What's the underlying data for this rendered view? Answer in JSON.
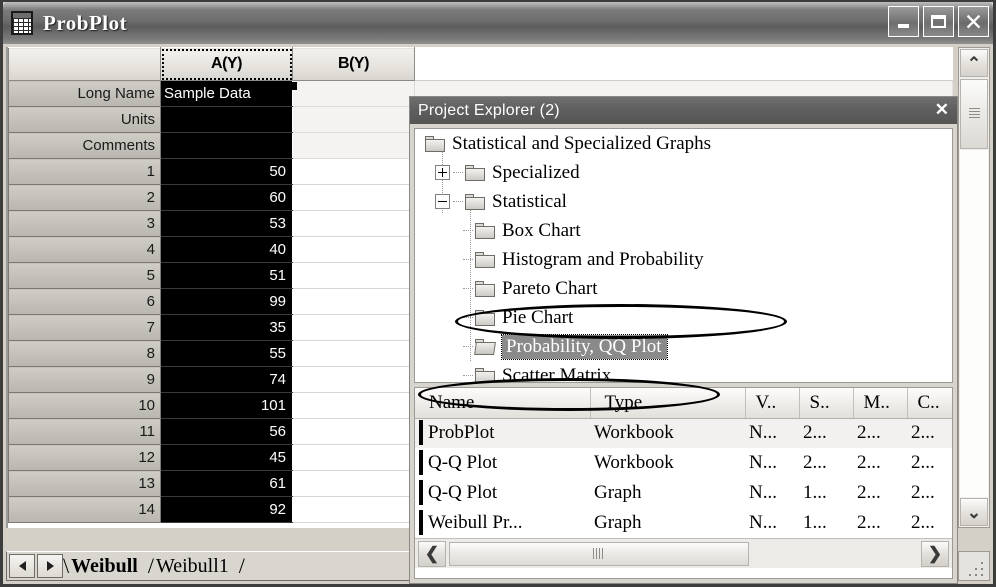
{
  "window": {
    "title": "ProbPlot",
    "icon": "workbook-icon",
    "buttons": {
      "minimize": "minimize-icon",
      "maximize": "maximize-icon",
      "close": "close-icon"
    }
  },
  "worksheet": {
    "columns": [
      {
        "id": "rowhdr",
        "label": ""
      },
      {
        "id": "A",
        "label": "A(Y)",
        "selected": true
      },
      {
        "id": "B",
        "label": "B(Y)",
        "selected": false
      }
    ],
    "meta_rows": [
      {
        "label": "Long Name",
        "a": "Sample Data",
        "b": ""
      },
      {
        "label": "Units",
        "a": "",
        "b": ""
      },
      {
        "label": "Comments",
        "a": "",
        "b": ""
      }
    ],
    "data_rows": [
      {
        "n": "1",
        "a": "50",
        "b": ""
      },
      {
        "n": "2",
        "a": "60",
        "b": ""
      },
      {
        "n": "3",
        "a": "53",
        "b": ""
      },
      {
        "n": "4",
        "a": "40",
        "b": ""
      },
      {
        "n": "5",
        "a": "51",
        "b": ""
      },
      {
        "n": "6",
        "a": "99",
        "b": ""
      },
      {
        "n": "7",
        "a": "35",
        "b": ""
      },
      {
        "n": "8",
        "a": "55",
        "b": ""
      },
      {
        "n": "9",
        "a": "74",
        "b": ""
      },
      {
        "n": "10",
        "a": "101",
        "b": ""
      },
      {
        "n": "11",
        "a": "56",
        "b": ""
      },
      {
        "n": "12",
        "a": "45",
        "b": ""
      },
      {
        "n": "13",
        "a": "61",
        "b": ""
      },
      {
        "n": "14",
        "a": "92",
        "b": ""
      }
    ]
  },
  "tabs": {
    "prev_label": "prev-sheet-icon",
    "next_label": "next-sheet-icon",
    "items": [
      {
        "label": "Weibull",
        "active": true
      },
      {
        "label": "Weibull1",
        "active": false
      }
    ],
    "separator": "/"
  },
  "project_explorer": {
    "title": "Project Explorer (2)",
    "close_label": "✕",
    "tree": [
      {
        "label": "Statistical and Specialized Graphs",
        "depth": 0,
        "expander": "none",
        "folder": "closed",
        "selected": false
      },
      {
        "label": "Specialized",
        "depth": 1,
        "expander": "plus",
        "folder": "closed",
        "selected": false
      },
      {
        "label": "Statistical",
        "depth": 1,
        "expander": "minus",
        "folder": "closed",
        "selected": false
      },
      {
        "label": "Box Chart",
        "depth": 2,
        "expander": "none",
        "folder": "closed",
        "selected": false
      },
      {
        "label": "Histogram and Probability",
        "depth": 2,
        "expander": "none",
        "folder": "closed",
        "selected": false
      },
      {
        "label": "Pareto Chart",
        "depth": 2,
        "expander": "none",
        "folder": "closed",
        "selected": false
      },
      {
        "label": "Pie Chart",
        "depth": 2,
        "expander": "none",
        "folder": "closed",
        "selected": false
      },
      {
        "label": "Probability, QQ Plot",
        "depth": 2,
        "expander": "none",
        "folder": "open",
        "selected": true
      },
      {
        "label": "Scatter Matrix",
        "depth": 2,
        "expander": "none",
        "folder": "closed",
        "selected": false
      }
    ],
    "list": {
      "headers": [
        "Name",
        "Type",
        "V..",
        "S..",
        "M..",
        "C.."
      ],
      "rows": [
        {
          "icon": "workbook-icon",
          "name": "ProbPlot",
          "type": "Workbook",
          "v": "N...",
          "s": "2...",
          "m": "2...",
          "c": "2...",
          "highlight": true
        },
        {
          "icon": "workbook-icon",
          "name": "Q-Q Plot",
          "type": "Workbook",
          "v": "N...",
          "s": "2...",
          "m": "2...",
          "c": "2...",
          "highlight": false
        },
        {
          "icon": "graph-icon",
          "name": "Q-Q Plot",
          "type": "Graph",
          "v": "N...",
          "s": "1...",
          "m": "2...",
          "c": "2...",
          "highlight": false
        },
        {
          "icon": "graph-icon",
          "name": "Weibull Pr...",
          "type": "Graph",
          "v": "N...",
          "s": "1...",
          "m": "2...",
          "c": "2...",
          "highlight": false
        }
      ]
    }
  },
  "scrollbars": {
    "left_arrow": "❮",
    "right_arrow": "❯",
    "up_arrow": "⌃",
    "down_arrow": "⌄"
  }
}
